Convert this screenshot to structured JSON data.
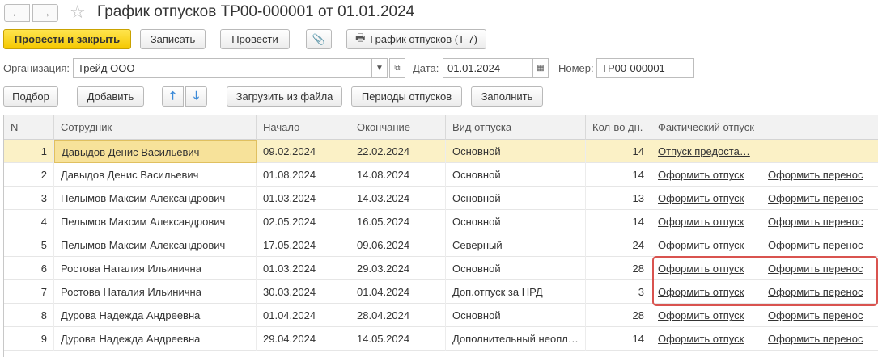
{
  "window": {
    "title": "График отпусков ТР00-000001 от 01.01.2024",
    "nav_back": "←",
    "nav_forward": "→",
    "star": "☆"
  },
  "toolbar": {
    "post_close": "Провести и закрыть",
    "save": "Записать",
    "post": "Провести",
    "attach_icon": "📎",
    "print_icon": "🖶",
    "print_label": "График отпусков (Т-7)"
  },
  "header": {
    "org_label": "Организация:",
    "org_value": "Трейд ООО",
    "date_label": "Дата:",
    "date_value": "01.01.2024",
    "number_label": "Номер:",
    "number_value": "ТР00-000001"
  },
  "table_toolbar": {
    "select": "Подбор",
    "add": "Добавить",
    "up": "🡑",
    "down": "🡓",
    "load_file": "Загрузить из файла",
    "periods": "Периоды отпусков",
    "fill": "Заполнить"
  },
  "table": {
    "columns": [
      "N",
      "Сотрудник",
      "Начало",
      "Окончание",
      "Вид отпуска",
      "Кол-во дн.",
      "Фактический отпуск"
    ],
    "rows": [
      {
        "n": "1",
        "employee": "Давыдов Денис Васильевич",
        "start": "09.02.2024",
        "end": "22.02.2024",
        "type": "Основной",
        "days": "14",
        "actual": "Отпуск предоста…",
        "transfer": ""
      },
      {
        "n": "2",
        "employee": "Давыдов Денис Васильевич",
        "start": "01.08.2024",
        "end": "14.08.2024",
        "type": "Основной",
        "days": "14",
        "actual": "Оформить отпуск",
        "transfer": "Оформить перенос"
      },
      {
        "n": "3",
        "employee": "Пелымов Максим Александрович",
        "start": "01.03.2024",
        "end": "14.03.2024",
        "type": "Основной",
        "days": "13",
        "actual": "Оформить отпуск",
        "transfer": "Оформить перенос"
      },
      {
        "n": "4",
        "employee": "Пелымов Максим Александрович",
        "start": "02.05.2024",
        "end": "16.05.2024",
        "type": "Основной",
        "days": "14",
        "actual": "Оформить отпуск",
        "transfer": "Оформить перенос"
      },
      {
        "n": "5",
        "employee": "Пелымов Максим Александрович",
        "start": "17.05.2024",
        "end": "09.06.2024",
        "type": "Северный",
        "days": "24",
        "actual": "Оформить отпуск",
        "transfer": "Оформить перенос"
      },
      {
        "n": "6",
        "employee": "Ростова Наталия Ильинична",
        "start": "01.03.2024",
        "end": "29.03.2024",
        "type": "Основной",
        "days": "28",
        "actual": "Оформить отпуск",
        "transfer": "Оформить перенос"
      },
      {
        "n": "7",
        "employee": "Ростова Наталия Ильинична",
        "start": "30.03.2024",
        "end": "01.04.2024",
        "type": "Доп.отпуск за НРД",
        "days": "3",
        "actual": "Оформить отпуск",
        "transfer": "Оформить перенос"
      },
      {
        "n": "8",
        "employee": "Дурова Надежда Андреевна",
        "start": "01.04.2024",
        "end": "28.04.2024",
        "type": "Основной",
        "days": "28",
        "actual": "Оформить отпуск",
        "transfer": "Оформить перенос"
      },
      {
        "n": "9",
        "employee": "Дурова Надежда Андреевна",
        "start": "29.04.2024",
        "end": "14.05.2024",
        "type": "Дополнительный неопл…",
        "days": "14",
        "actual": "Оформить отпуск",
        "transfer": "Оформить перенос"
      }
    ]
  }
}
